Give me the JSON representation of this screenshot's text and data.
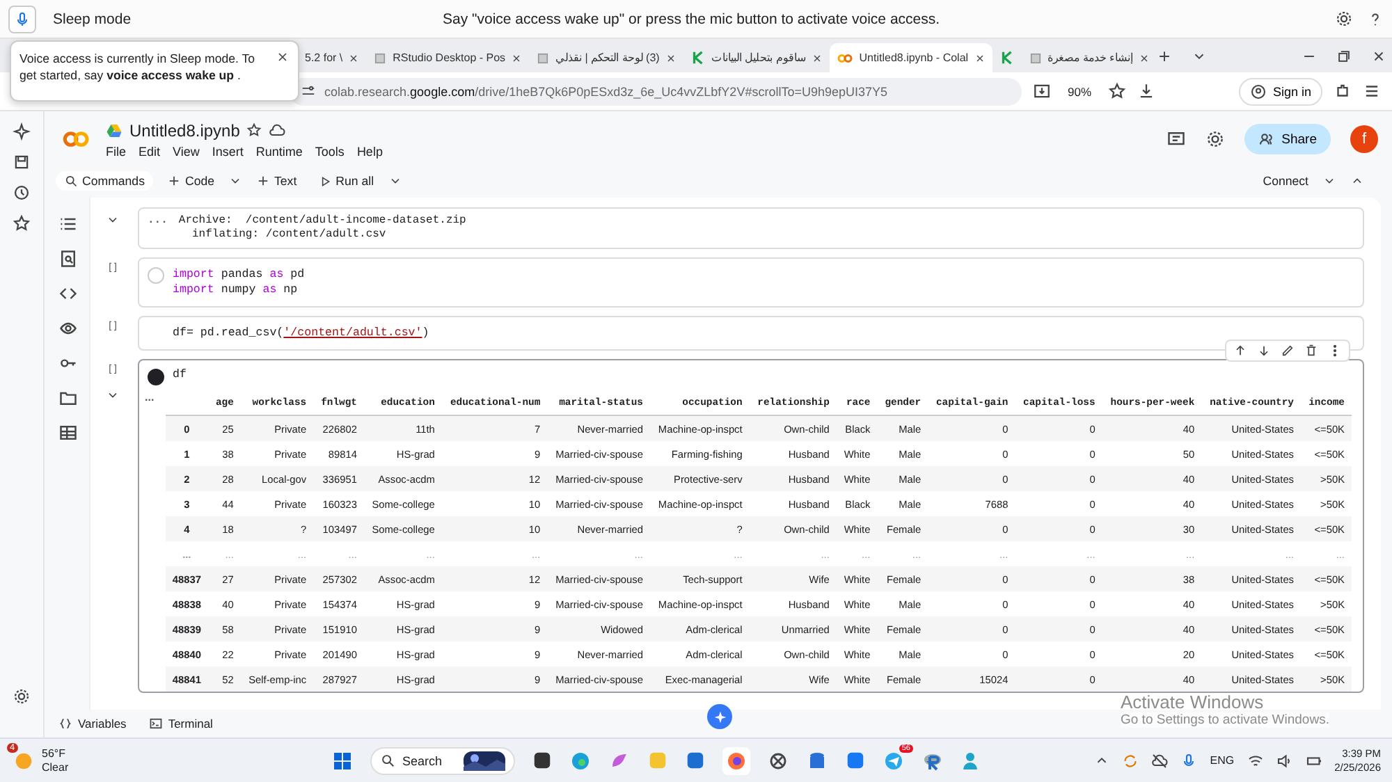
{
  "voice_bar": {
    "status": "Sleep mode",
    "message": "Say \"voice access wake up\" or press the mic button to activate voice access."
  },
  "voice_popup": {
    "text": "Voice access is currently in Sleep mode. To get started, say **voice access wake up** ."
  },
  "browser_tabs": [
    {
      "label": "5.2 for \\",
      "kind": "page",
      "selected": false
    },
    {
      "label": "RStudio Desktop - Pos",
      "kind": "page",
      "selected": false
    },
    {
      "label": "(3) لوحة التحكم | نقذلي",
      "kind": "page",
      "selected": false
    },
    {
      "label": "ساقوم بتحليل البيانات",
      "kind": "k",
      "selected": false
    },
    {
      "label": "Untitled8.ipynb - Colal",
      "kind": "colab",
      "selected": true
    },
    {
      "kind": "k",
      "selected": false
    },
    {
      "label": "إنشاء خدمة مصغرة",
      "kind": "page",
      "selected": false
    }
  ],
  "address_bar": {
    "url_prefix": "colab.research.",
    "url_domain": "google.com",
    "url_path": "/drive/1heB7Qk6P0pESxd3z_6e_Uc4vvZLbfY2V#scrollTo=U9h9epUI37Y5",
    "zoom": "90%",
    "sign_in": "Sign in"
  },
  "notebook": {
    "title": "Untitled8.ipynb",
    "menu": [
      "File",
      "Edit",
      "View",
      "Insert",
      "Runtime",
      "Tools",
      "Help"
    ],
    "share": "Share",
    "avatar": "f"
  },
  "toolbar": {
    "commands": "Commands",
    "code": "Code",
    "text": "Text",
    "run_all": "Run all",
    "connect": "Connect"
  },
  "cells": [
    {
      "kind": "output",
      "selected": false,
      "marker": "...",
      "lines": [
        "Archive:  /content/adult-income-dataset.zip",
        "  inflating: /content/adult.csv"
      ]
    },
    {
      "kind": "code",
      "selected": false,
      "bracket": "[ ]",
      "lines": [
        [
          {
            "text": "import",
            "kind": "keyword"
          },
          {
            "text": " pandas ",
            "kind": "plain"
          },
          {
            "text": "as",
            "kind": "keyword"
          },
          {
            "text": " pd",
            "kind": "plain"
          }
        ],
        [
          {
            "text": "import",
            "kind": "keyword"
          },
          {
            "text": " numpy ",
            "kind": "plain"
          },
          {
            "text": "as",
            "kind": "keyword"
          },
          {
            "text": " np",
            "kind": "plain"
          }
        ]
      ]
    },
    {
      "kind": "code",
      "selected": false,
      "bracket": "[ ]",
      "lines": [
        [
          {
            "text": "df= pd.read_csv(",
            "kind": "plain"
          },
          {
            "text": "'/content/adult.csv'",
            "kind": "string"
          },
          {
            "text": ")",
            "kind": "plain"
          }
        ]
      ]
    },
    {
      "kind": "dataframe",
      "selected": true,
      "bracket": "[ ]",
      "marker": "...",
      "lines": [
        [
          {
            "text": "df",
            "kind": "plain"
          }
        ]
      ],
      "table": {
        "columns": [
          "age",
          "workclass",
          "fnlwgt",
          "education",
          "educational-num",
          "marital-status",
          "occupation",
          "relationship",
          "race",
          "gender",
          "capital-gain",
          "capital-loss",
          "hours-per-week",
          "native-country",
          "income"
        ],
        "rows": [
          {
            "kind": "data",
            "index": "0",
            "cells": [
              "25",
              "Private",
              "226802",
              "11th",
              "7",
              "Never-married",
              "Machine-op-inspct",
              "Own-child",
              "Black",
              "Male",
              "0",
              "0",
              "40",
              "United-States",
              "<=50K"
            ]
          },
          {
            "kind": "data",
            "index": "1",
            "cells": [
              "38",
              "Private",
              "89814",
              "HS-grad",
              "9",
              "Married-civ-spouse",
              "Farming-fishing",
              "Husband",
              "White",
              "Male",
              "0",
              "0",
              "50",
              "United-States",
              "<=50K"
            ]
          },
          {
            "kind": "data",
            "index": "2",
            "cells": [
              "28",
              "Local-gov",
              "336951",
              "Assoc-acdm",
              "12",
              "Married-civ-spouse",
              "Protective-serv",
              "Husband",
              "White",
              "Male",
              "0",
              "0",
              "40",
              "United-States",
              ">50K"
            ]
          },
          {
            "kind": "data",
            "index": "3",
            "cells": [
              "44",
              "Private",
              "160323",
              "Some-college",
              "10",
              "Married-civ-spouse",
              "Machine-op-inspct",
              "Husband",
              "Black",
              "Male",
              "7688",
              "0",
              "40",
              "United-States",
              ">50K"
            ]
          },
          {
            "kind": "data",
            "index": "4",
            "cells": [
              "18",
              "?",
              "103497",
              "Some-college",
              "10",
              "Never-married",
              "?",
              "Own-child",
              "White",
              "Female",
              "0",
              "0",
              "30",
              "United-States",
              "<=50K"
            ]
          },
          {
            "kind": "ellipsis",
            "index": "...",
            "cells": [
              "...",
              "...",
              "...",
              "...",
              "...",
              "...",
              "...",
              "...",
              "...",
              "...",
              "...",
              "...",
              "...",
              "...",
              "..."
            ]
          },
          {
            "kind": "data",
            "index": "48837",
            "cells": [
              "27",
              "Private",
              "257302",
              "Assoc-acdm",
              "12",
              "Married-civ-spouse",
              "Tech-support",
              "Wife",
              "White",
              "Female",
              "0",
              "0",
              "38",
              "United-States",
              "<=50K"
            ]
          },
          {
            "kind": "data",
            "index": "48838",
            "cells": [
              "40",
              "Private",
              "154374",
              "HS-grad",
              "9",
              "Married-civ-spouse",
              "Machine-op-inspct",
              "Husband",
              "White",
              "Male",
              "0",
              "0",
              "40",
              "United-States",
              ">50K"
            ]
          },
          {
            "kind": "data",
            "index": "48839",
            "cells": [
              "58",
              "Private",
              "151910",
              "HS-grad",
              "9",
              "Widowed",
              "Adm-clerical",
              "Unmarried",
              "White",
              "Female",
              "0",
              "0",
              "40",
              "United-States",
              "<=50K"
            ]
          },
          {
            "kind": "data",
            "index": "48840",
            "cells": [
              "22",
              "Private",
              "201490",
              "HS-grad",
              "9",
              "Never-married",
              "Adm-clerical",
              "Own-child",
              "White",
              "Male",
              "0",
              "0",
              "20",
              "United-States",
              "<=50K"
            ]
          },
          {
            "kind": "data",
            "index": "48841",
            "cells": [
              "52",
              "Self-emp-inc",
              "287927",
              "HS-grad",
              "9",
              "Married-civ-spouse",
              "Exec-managerial",
              "Wife",
              "White",
              "Female",
              "15024",
              "0",
              "40",
              "United-States",
              ">50K"
            ]
          }
        ]
      }
    }
  ],
  "bottom_bar": {
    "variables": "Variables",
    "terminal": "Terminal"
  },
  "activation": {
    "title": "Activate Windows",
    "hint": "Go to Settings to activate Windows."
  },
  "taskbar": {
    "weather_badge": "4",
    "temperature": "56°F",
    "condition": "Clear",
    "search": "Search",
    "telegram_badge": "56",
    "language": "ENG",
    "time": "3:39 PM",
    "date": "2/25/2026"
  }
}
